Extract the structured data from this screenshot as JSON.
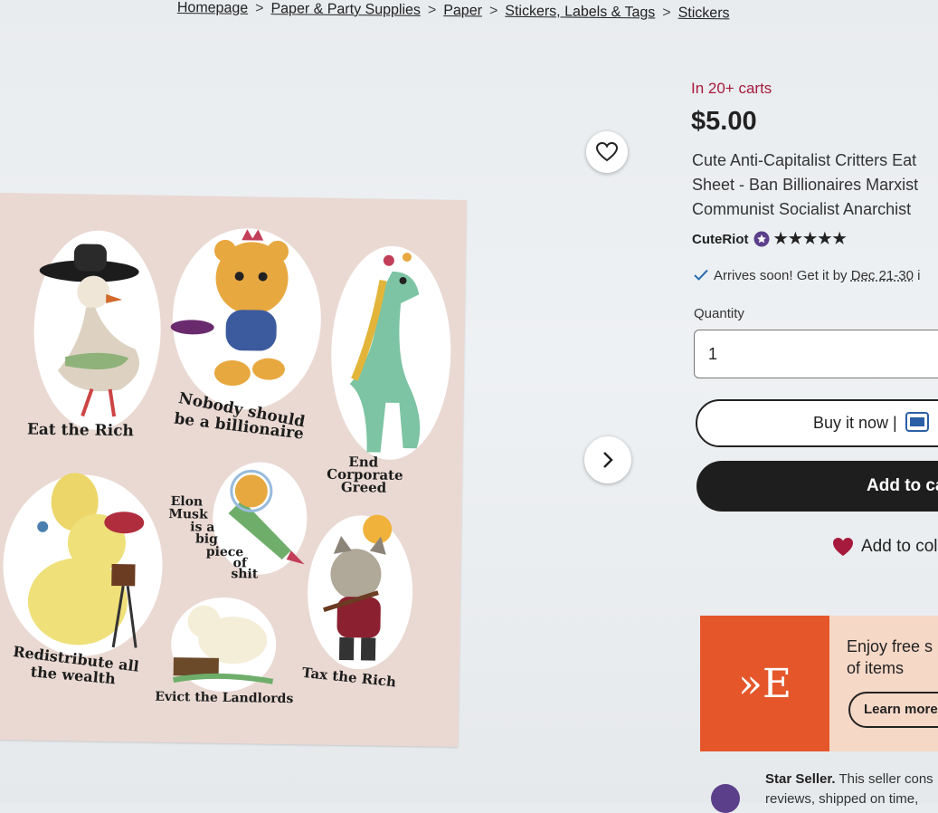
{
  "breadcrumb": [
    "Homepage",
    "Paper & Party Supplies",
    "Paper",
    "Stickers, Labels & Tags",
    "Stickers"
  ],
  "stickers": {
    "s1": "Eat the Rich",
    "s2a": "Nobody should",
    "s2b": "be a billionaire",
    "s3a": "End",
    "s3b": "Corporate",
    "s3c": "Greed",
    "s4a": "Elon",
    "s4b": "Musk",
    "s4c": "is a",
    "s4d": "big",
    "s4e": "piece",
    "s4f": "of",
    "s4g": "shit",
    "s5a": "Redistribute all",
    "s5b": "the wealth",
    "s6": "Evict the Landlords",
    "s7": "Tax the Rich"
  },
  "product": {
    "in_carts": "In 20+ carts",
    "price": "$5.00",
    "title_line1": "Cute Anti-Capitalist Critters Eat",
    "title_line2": "Sheet - Ban Billionaires Marxist",
    "title_line3": "Communist Socialist Anarchist",
    "shop_name": "CuteRiot",
    "stars": "★★★★★",
    "arrives_text": "Arrives soon! Get it by",
    "arrives_date": "Dec 21-30",
    "arrives_tail": " i",
    "quantity_label": "Quantity",
    "quantity_value": "1",
    "buy_now": "Buy it now |",
    "add_to_cart": "Add to ca",
    "add_to_collection": "Add to col"
  },
  "promo": {
    "logo": "»E",
    "line1": "Enjoy free s",
    "line2": "of items",
    "learn_more": "Learn more"
  },
  "star_seller": {
    "label": "Star Seller.",
    "text1": " This seller cons",
    "text2": "reviews, shipped on time,"
  },
  "colors": {
    "accent_red": "#a61a3d",
    "etsy_orange": "#e5572b",
    "dark_button": "#1e1e1e"
  }
}
